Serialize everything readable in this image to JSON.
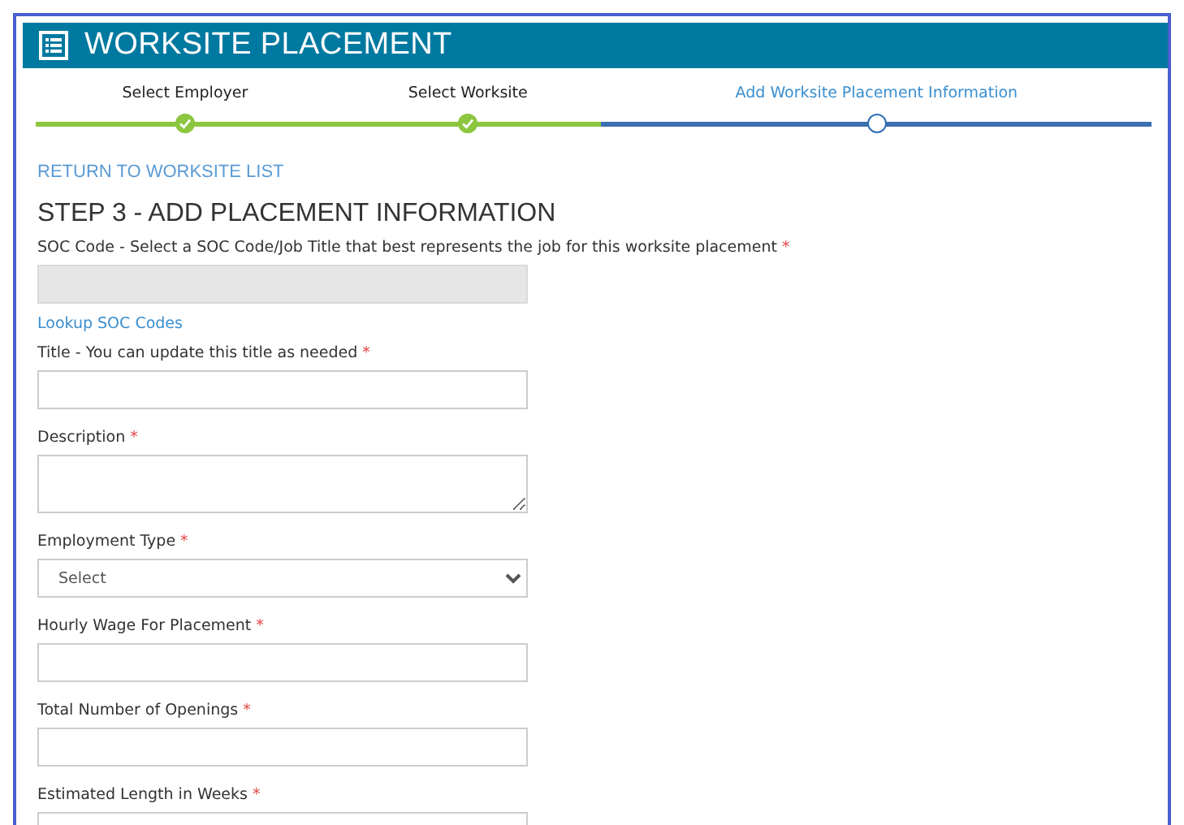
{
  "header": {
    "title": "WORKSITE PLACEMENT"
  },
  "steps": [
    {
      "label": "Select Employer",
      "completed": true,
      "selected": false
    },
    {
      "label": "Select Worksite",
      "completed": true,
      "selected": false
    },
    {
      "label": "Add Worksite Placement Information",
      "completed": false,
      "selected": true
    }
  ],
  "back_link": "RETURN TO WORKSITE LIST",
  "step_title": "STEP 3 - ADD PLACEMENT INFORMATION",
  "fields": [
    {
      "label": "SOC Code - Select a SOC Code/Job Title that best represents the job for this worksite placement",
      "required_mark": "*",
      "kind": "text",
      "disabled": true,
      "link": "Lookup SOC Codes"
    },
    {
      "label": "Title - You can update this title as needed",
      "required_mark": "*",
      "kind": "text",
      "disabled": false
    },
    {
      "label": "Description",
      "required_mark": "*",
      "kind": "textarea",
      "disabled": false
    },
    {
      "label": "Employment Type",
      "required_mark": "*",
      "kind": "select",
      "disabled": false,
      "placeholder": "Select"
    },
    {
      "label": "Hourly Wage For Placement",
      "required_mark": "*",
      "kind": "text",
      "disabled": false
    },
    {
      "label": "Total Number of Openings",
      "required_mark": "*",
      "kind": "text",
      "disabled": false
    },
    {
      "label": "Estimated Length in Weeks",
      "required_mark": "*",
      "kind": "text",
      "disabled": false
    }
  ]
}
